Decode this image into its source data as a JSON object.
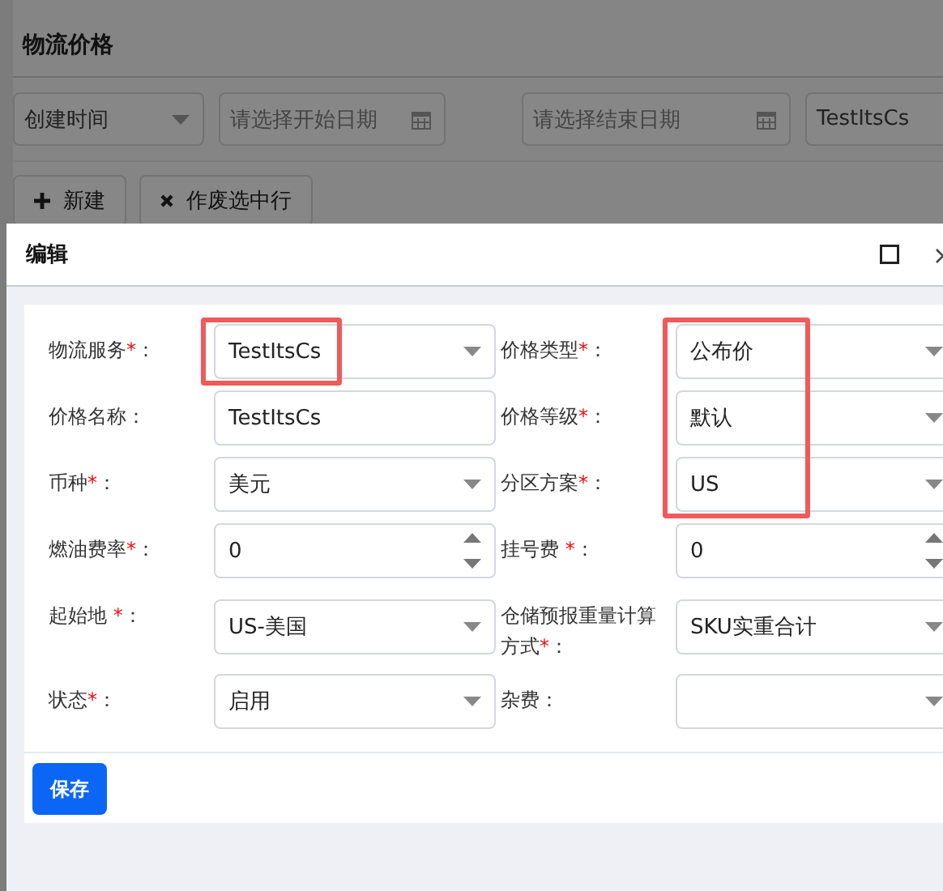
{
  "page": {
    "title": "物流价格"
  },
  "filters": [
    {
      "kind": "select",
      "value": "创建时间"
    },
    {
      "kind": "date",
      "placeholder": "请选择开始日期"
    },
    {
      "kind": "date",
      "placeholder": "请选择结束日期"
    },
    {
      "kind": "text",
      "value": "TestItsCs"
    }
  ],
  "toolbar": [
    {
      "kind": "add",
      "label": "新建"
    },
    {
      "kind": "void",
      "label": "作废选中行"
    }
  ],
  "dialog": {
    "title": "编辑",
    "fields": [
      {
        "label": "物流服务",
        "required": true,
        "colon": "：",
        "kind": "select",
        "value": "TestItsCs",
        "highlighted": true
      },
      {
        "label": "价格类型",
        "required": true,
        "colon": "：",
        "kind": "select",
        "value": "公布价",
        "highlighted": true
      },
      {
        "label": "价格名称",
        "required": false,
        "colon": "：",
        "kind": "text",
        "value": "TestItsCs",
        "highlighted": false
      },
      {
        "label": "价格等级",
        "required": true,
        "colon": "：",
        "kind": "select",
        "value": "默认",
        "highlighted": true
      },
      {
        "label": "币种",
        "required": true,
        "colon": "：",
        "kind": "select",
        "value": "美元",
        "highlighted": false
      },
      {
        "label": "分区方案",
        "required": true,
        "colon": "：",
        "kind": "select",
        "value": "US",
        "highlighted": true
      },
      {
        "label": "燃油费率",
        "required": true,
        "colon": "：",
        "kind": "number",
        "value": "0",
        "highlighted": false
      },
      {
        "label": "挂号费 ",
        "required": true,
        "colon": "：",
        "kind": "number",
        "value": "0",
        "highlighted": false
      },
      {
        "label": "起始地 ",
        "required": true,
        "colon": "：",
        "kind": "select",
        "value": "US-美国",
        "highlighted": false
      },
      {
        "label": "仓储预报重量计算方式",
        "required": true,
        "colon": "：",
        "kind": "select",
        "value": "SKU实重合计",
        "highlighted": false
      },
      {
        "label": "状态",
        "required": true,
        "colon": "：",
        "kind": "select",
        "value": "启用",
        "highlighted": false
      },
      {
        "label": "杂费",
        "required": false,
        "colon": "：",
        "kind": "select",
        "highlighted": false
      }
    ],
    "required_mark": "*",
    "save_button": "保存"
  }
}
